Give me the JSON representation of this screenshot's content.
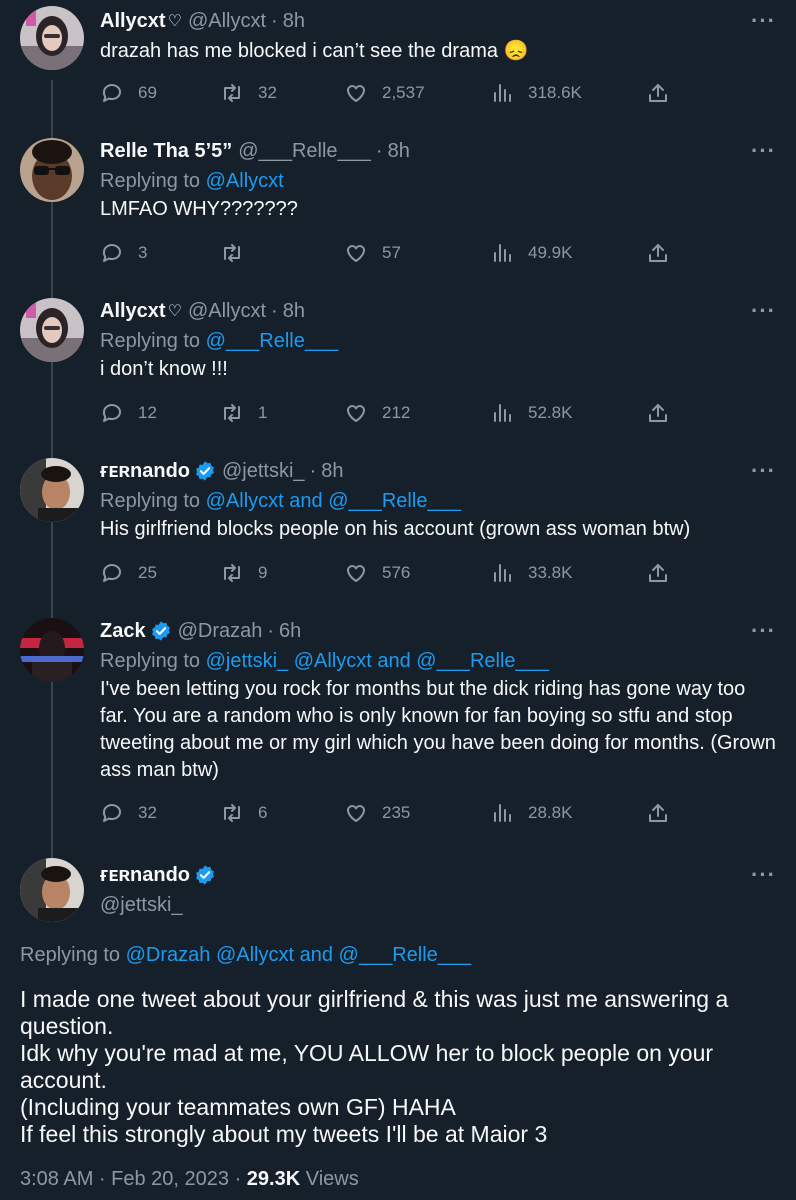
{
  "tweets": [
    {
      "name": "Allycxt",
      "name_suffix": "♡",
      "handle": "@Allycxt",
      "time": "8h",
      "verified": false,
      "replying_label": "",
      "replying_to": "",
      "text": "drazah has me blocked i can’t see the drama 😞",
      "replies": "69",
      "retweets": "32",
      "likes": "2,537",
      "views": "318.6K"
    },
    {
      "name": "Relle Tha 5’5”",
      "name_suffix": "",
      "handle": "@___Relle___",
      "time": "8h",
      "verified": false,
      "replying_label": "Replying to",
      "replying_to": "@Allycxt",
      "text": "LMFAO WHY???????",
      "replies": "3",
      "retweets": "",
      "likes": "57",
      "views": "49.9K"
    },
    {
      "name": "Allycxt",
      "name_suffix": "♡",
      "handle": "@Allycxt",
      "time": "8h",
      "verified": false,
      "replying_label": "Replying to",
      "replying_to": "@___Relle___",
      "text": "i don’t know !!!",
      "replies": "12",
      "retweets": "1",
      "likes": "212",
      "views": "52.8K"
    },
    {
      "name": "ғᴇʀnando",
      "name_suffix": "",
      "handle": "@jettski_",
      "time": "8h",
      "verified": true,
      "replying_label": "Replying to",
      "replying_to": "@Allycxt and @___Relle___",
      "text": "His girlfriend blocks people on his account (grown ass woman btw)",
      "replies": "25",
      "retweets": "9",
      "likes": "576",
      "views": "33.8K"
    },
    {
      "name": "Zack",
      "name_suffix": "",
      "handle": "@Drazah",
      "time": "6h",
      "verified": true,
      "replying_label": "Replying to",
      "replying_to": "@jettski_ @Allycxt and @___Relle___",
      "text": "I've been letting you rock for months but the dick riding has gone way too far. You are a random who is only known for fan boying so stfu and stop tweeting about me or my girl which you have been doing for months. (Grown ass man btw)",
      "replies": "32",
      "retweets": "6",
      "likes": "235",
      "views": "28.8K"
    }
  ],
  "main_tweet": {
    "name": "ғᴇʀnando",
    "handle": "@jettski_",
    "replying_label": "Replying to",
    "replying_to": "@Drazah @Allycxt and @___Relle___",
    "text_lines": [
      "I made one tweet about your girlfriend & this was just me answering a",
      "question.",
      "Idk why you're mad at me, YOU ALLOW her to block people on your",
      "account.",
      "(Including your teammates own GF) HAHA",
      "If feel this strongly about my tweets I'll be at Maior 3"
    ],
    "timestamp": "3:08 AM · Feb 20, 2023 · ",
    "views_count": "29.3K",
    "views_label": " Views"
  },
  "icons": {
    "reply": "reply-icon",
    "retweet": "retweet-icon",
    "like": "like-icon",
    "views": "views-icon",
    "share": "share-icon",
    "more": "more-icon",
    "verified": "verified-badge-icon"
  },
  "colors": {
    "background": "#15202b",
    "link": "#1d9bf0",
    "muted": "#8b98a5",
    "thread_line": "#38444d"
  }
}
